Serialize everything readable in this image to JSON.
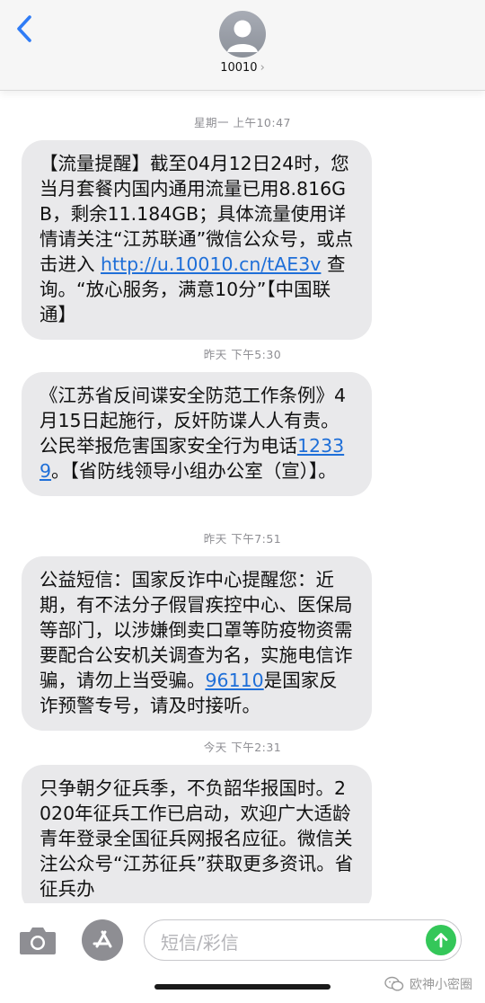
{
  "header": {
    "contact": "10010",
    "chevron": "›"
  },
  "messages": [
    {
      "timestamp": "星期一 上午10:47",
      "segments": [
        {
          "text": "【流量提醒】截至04月12日24时，您当月套餐内国内通用流量已用8.816GB，剩余11.184GB；具体流量使用详情请关注“江苏联通”微信公众号，或点击进入 "
        },
        {
          "text": "http://u.10010.cn/tAE3v",
          "link": true
        },
        {
          "text": " 查询。“放心服务，满意10分”【中国联通】"
        }
      ]
    },
    {
      "timestamp": "昨天 下午5:30",
      "segments": [
        {
          "text": "《江苏省反间谍安全防范工作条例》4月15日起施行，反奸防谍人人有责。公民举报危害国家安全行为电话"
        },
        {
          "text": "12339",
          "link": true
        },
        {
          "text": "。【省防线领导小组办公室（宣）】。"
        }
      ]
    },
    {
      "timestamp": "昨天 下午7:51",
      "segments": [
        {
          "text": "公益短信：国家反诈中心提醒您：近期，有不法分子假冒疾控中心、医保局等部门，以涉嫌倒卖口罩等防疫物资需要配合公安机关调查为名，实施电信诈骗，请勿上当受骗。"
        },
        {
          "text": "96110",
          "link": true
        },
        {
          "text": "是国家反诈预警专号，请及时接听。"
        }
      ]
    },
    {
      "timestamp": "今天 下午2:31",
      "segments": [
        {
          "text": "只争朝夕征兵季，不负韶华报国时。2020年征兵工作已启动，欢迎广大适龄青年登录全国征兵网报名应征。微信关注公众号“江苏征兵”获取更多资讯。省征兵办"
        }
      ]
    }
  ],
  "input": {
    "placeholder": "短信/彩信"
  },
  "watermark": {
    "text": "欧神小密圈"
  },
  "colors": {
    "bubble": "#e9e9eb",
    "link": "#1f6fd8",
    "send": "#34c759",
    "back": "#2f7cf6"
  },
  "icons": {
    "back": "chevron-left-icon",
    "avatar": "person-icon",
    "camera": "camera-icon",
    "appstore": "app-store-icon",
    "send": "arrow-up-icon",
    "watermark": "wechat-icon"
  }
}
